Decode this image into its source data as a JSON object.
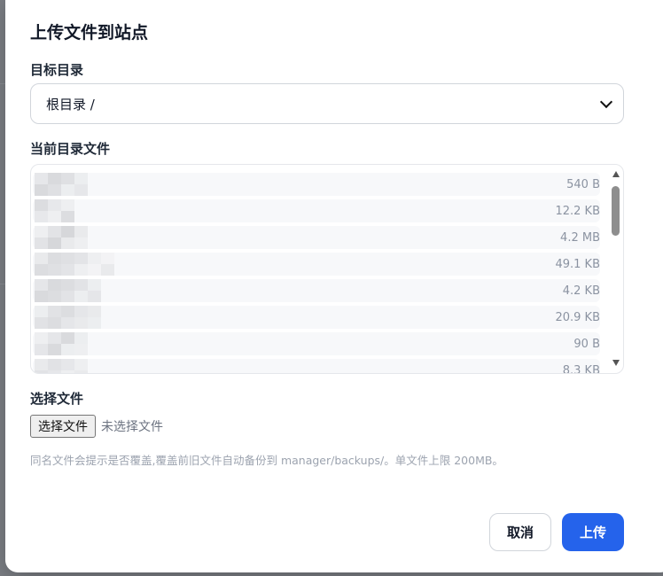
{
  "dialog": {
    "title": "上传文件到站点",
    "target_label": "目标目录",
    "target_value": "根目录 /",
    "files_label": "当前目录文件",
    "files": [
      {
        "size": "540 B"
      },
      {
        "size": "12.2 KB"
      },
      {
        "size": "4.2 MB"
      },
      {
        "size": "49.1 KB"
      },
      {
        "size": "4.2 KB"
      },
      {
        "size": "20.9 KB"
      },
      {
        "size": "90 B"
      },
      {
        "size": "8.3 KB"
      }
    ],
    "choose_label": "选择文件",
    "choose_button": "选择文件",
    "choose_status": "未选择文件",
    "hint": "同名文件会提示是否覆盖,覆盖前旧文件自动备份到 manager/backups/。单文件上限 200MB。",
    "cancel_label": "取消",
    "upload_label": "上传"
  },
  "colors": {
    "primary": "#2563eb",
    "overlay": "#7b7e84"
  }
}
